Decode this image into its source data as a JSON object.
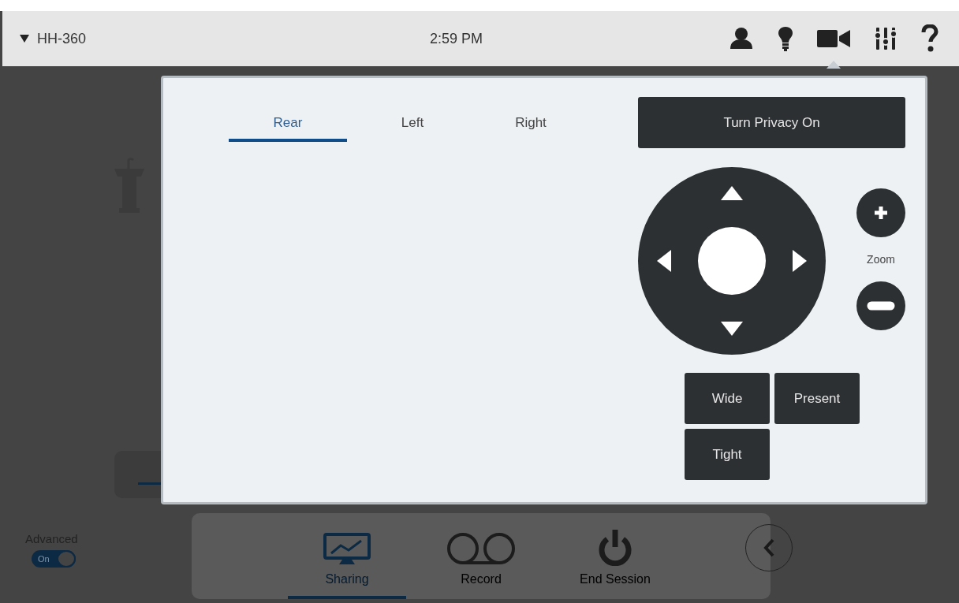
{
  "header": {
    "device": "HH-360",
    "time": "2:59 PM"
  },
  "header_icons": [
    {
      "kind": "person",
      "selected": false
    },
    {
      "kind": "bulb",
      "selected": false
    },
    {
      "kind": "camera",
      "selected": true
    },
    {
      "kind": "mixer",
      "selected": false
    },
    {
      "kind": "help",
      "selected": false
    }
  ],
  "camera_panel": {
    "tabs": [
      {
        "label": "Rear",
        "selected": true
      },
      {
        "label": "Left",
        "selected": false
      },
      {
        "label": "Right",
        "selected": false
      }
    ],
    "privacy_button": "Turn Privacy On",
    "zoom_label": "Zoom",
    "presets": [
      "Wide",
      "Present",
      "Tight"
    ]
  },
  "bottom_bar": {
    "items": [
      {
        "kind": "sharing",
        "label": "Sharing",
        "selected": true
      },
      {
        "kind": "record",
        "label": "Record",
        "selected": false
      },
      {
        "kind": "power",
        "label": "End Session",
        "selected": false
      }
    ]
  },
  "advanced": {
    "label": "Advanced",
    "toggle_text": "On",
    "on": true
  }
}
